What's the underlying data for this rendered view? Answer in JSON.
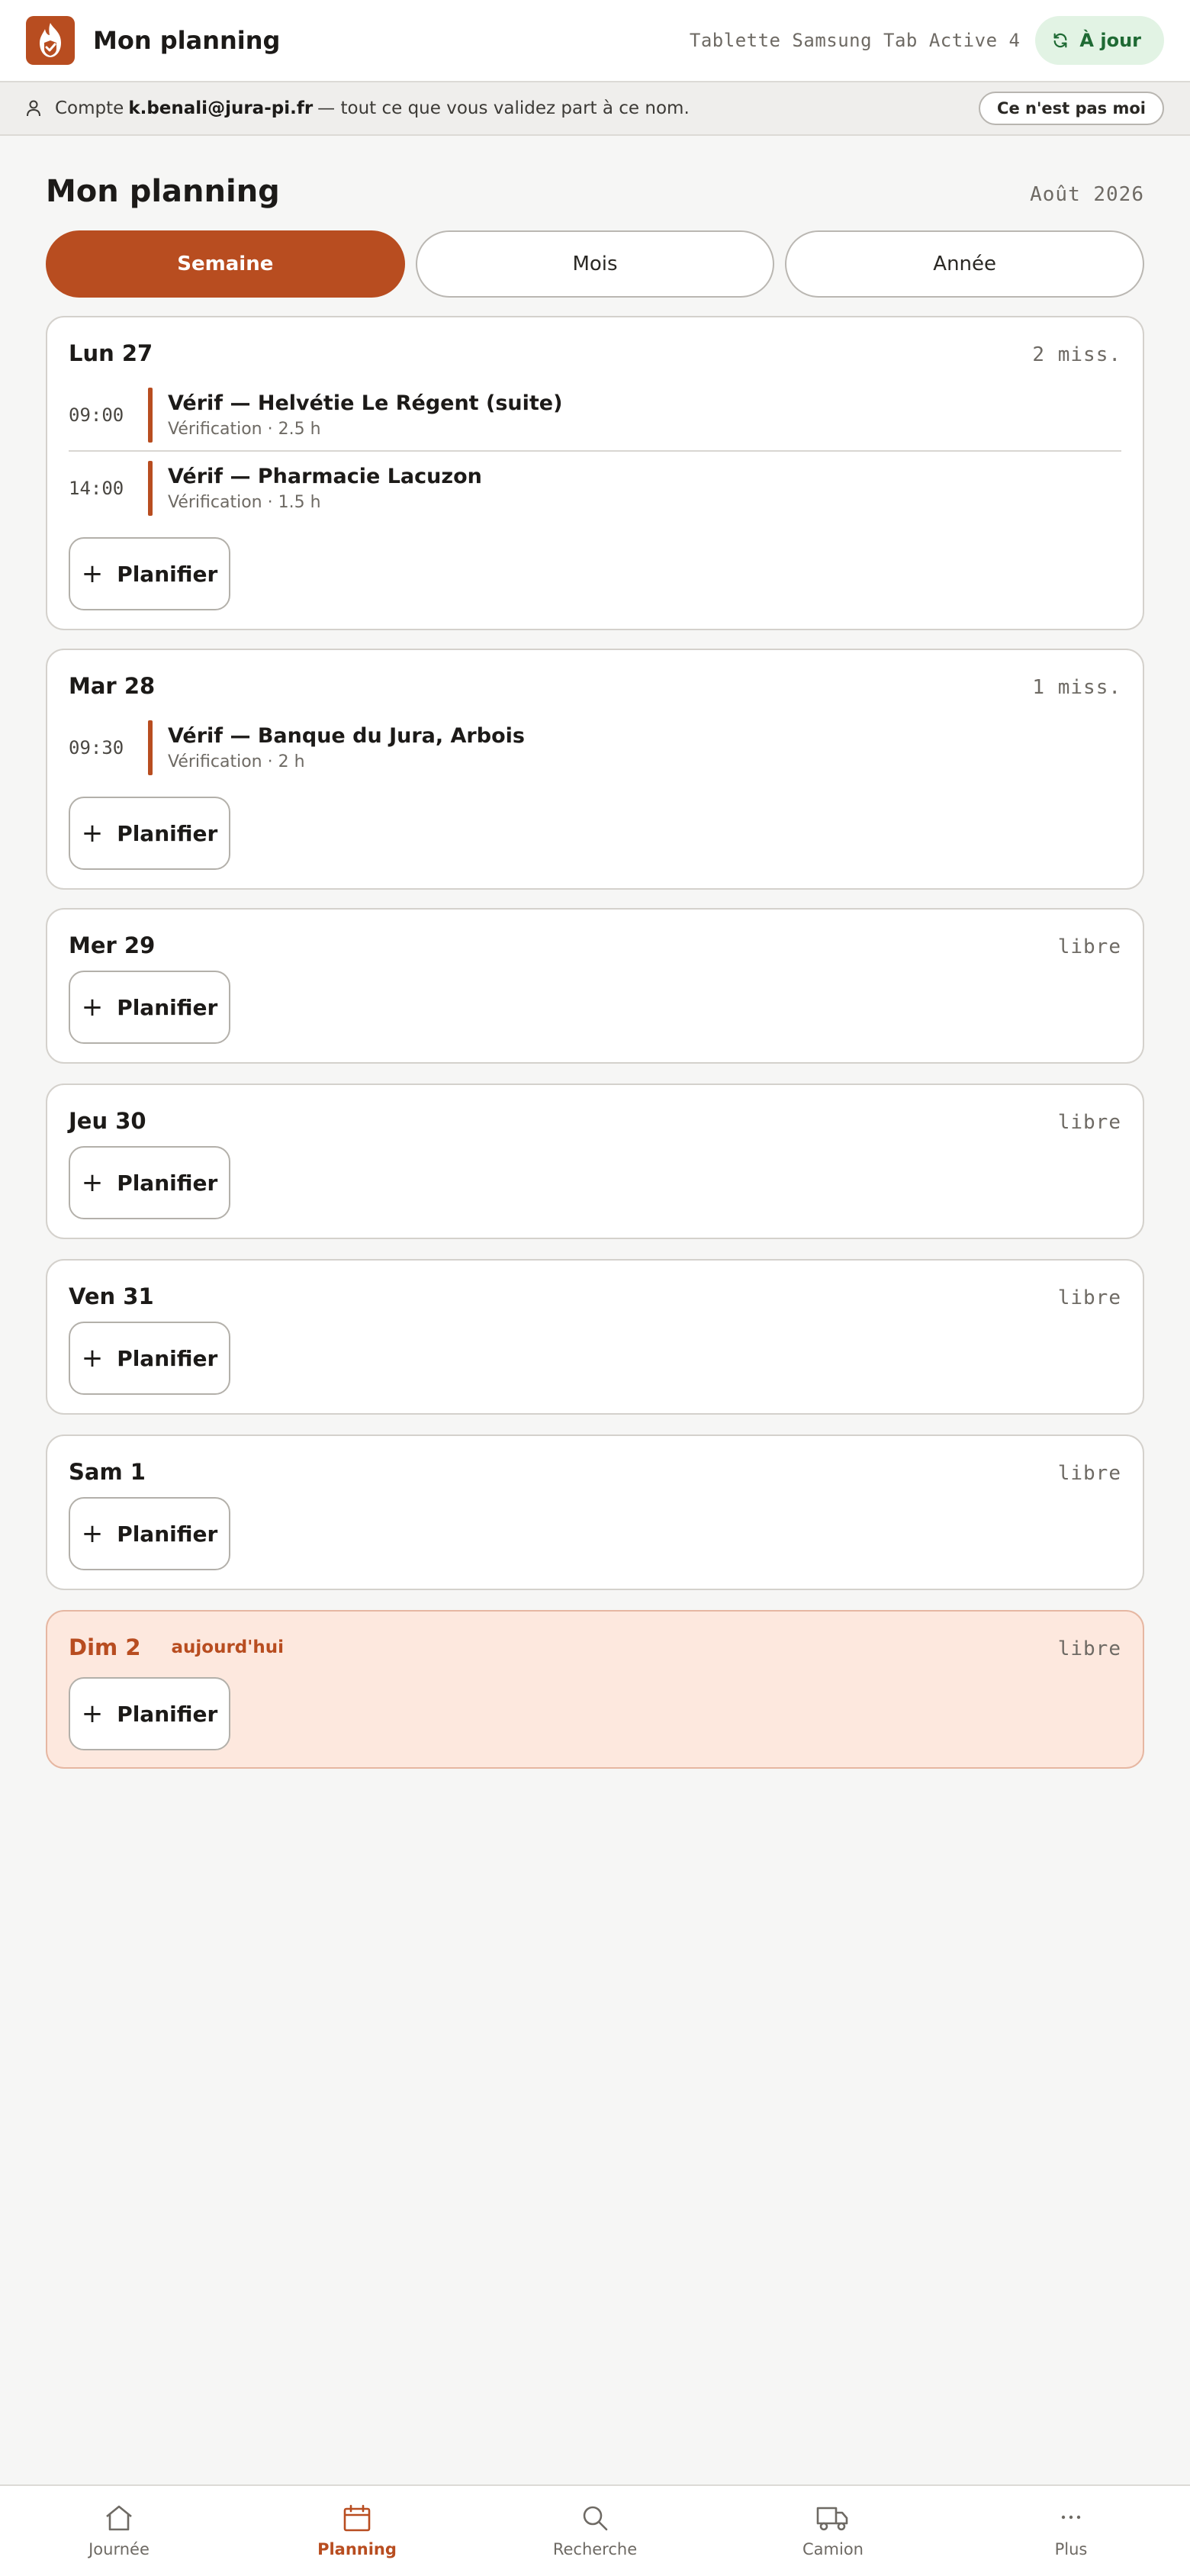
{
  "header": {
    "app_title": "Mon planning",
    "device": "Tablette Samsung Tab Active 4",
    "sync_status": "À jour",
    "brand_color": "#b84d20",
    "logo_icon": "flame-shield-icon"
  },
  "account": {
    "prefix": "Compte",
    "email": "k.benali@jura-pi.fr",
    "suffix": "— tout ce que vous validez part à ce nom.",
    "not_me_label": "Ce n'est pas moi"
  },
  "page": {
    "title": "Mon planning",
    "period": "Août 2026"
  },
  "views": [
    {
      "label": "Semaine",
      "active": true
    },
    {
      "label": "Mois",
      "active": false
    },
    {
      "label": "Année",
      "active": false
    }
  ],
  "plan_label": "Planifier",
  "today_tag": "aujourd'hui",
  "days": [
    {
      "label": "Lun 27",
      "count": "2 miss.",
      "missions": [
        {
          "time": "09:00",
          "title": "Vérif — Helvétie Le Régent (suite)",
          "sub": "Vérification · 2.5 h"
        },
        {
          "time": "14:00",
          "title": "Vérif — Pharmacie Lacuzon",
          "sub": "Vérification · 1.5 h"
        }
      ]
    },
    {
      "label": "Mar 28",
      "count": "1 miss.",
      "missions": [
        {
          "time": "09:30",
          "title": "Vérif — Banque du Jura, Arbois",
          "sub": "Vérification · 2 h"
        }
      ]
    },
    {
      "label": "Mer 29",
      "count": "libre",
      "missions": []
    },
    {
      "label": "Jeu 30",
      "count": "libre",
      "missions": []
    },
    {
      "label": "Ven 31",
      "count": "libre",
      "missions": []
    },
    {
      "label": "Sam 1",
      "count": "libre",
      "missions": []
    },
    {
      "label": "Dim 2",
      "count": "libre",
      "today": true,
      "missions": []
    }
  ],
  "nav": [
    {
      "label": "Journée",
      "icon": "home-icon",
      "active": false
    },
    {
      "label": "Planning",
      "icon": "calendar-icon",
      "active": true
    },
    {
      "label": "Recherche",
      "icon": "search-icon",
      "active": false
    },
    {
      "label": "Camion",
      "icon": "truck-icon",
      "active": false
    },
    {
      "label": "Plus",
      "icon": "more-icon",
      "active": false
    }
  ]
}
